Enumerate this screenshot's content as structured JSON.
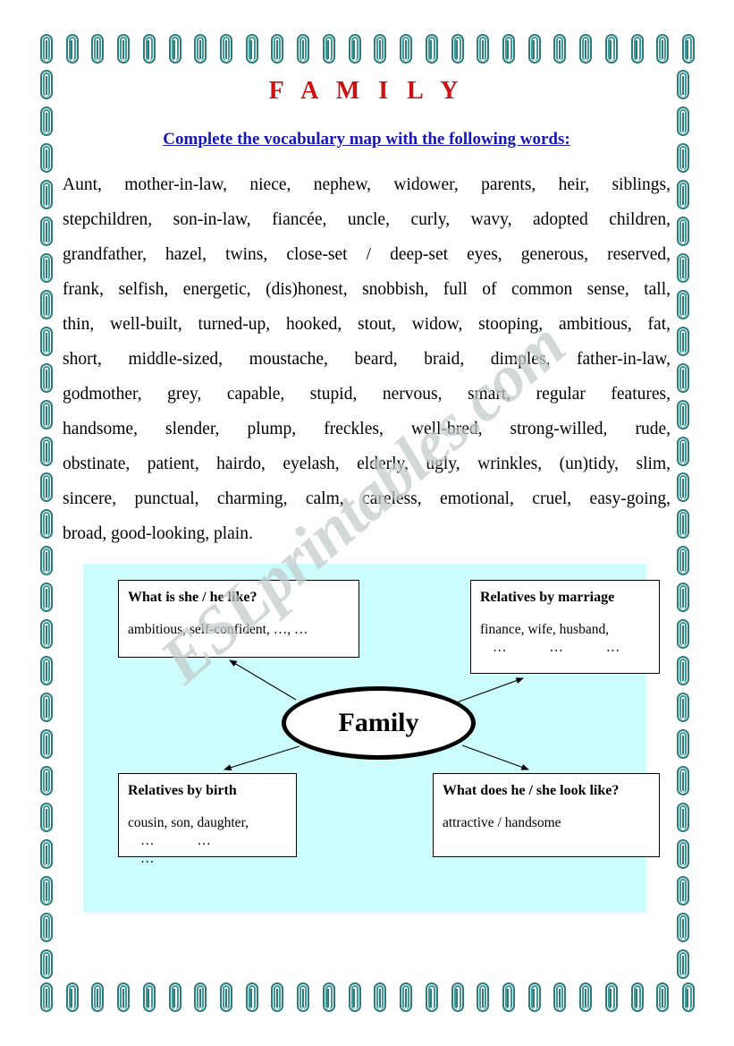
{
  "page": {
    "title": "F A M I L Y",
    "title_color": "#cc1111",
    "subtitle": "Complete the vocabulary map with the following words:",
    "subtitle_color": "#1717b5",
    "watermark": "ESLprintables.com",
    "border_icon": "paperclip-icon",
    "border_color": "#2c7c7c",
    "panel_color": "#ccfcfc"
  },
  "wordlist": {
    "lines": [
      "Aunt, mother-in-law, niece, nephew, widower, parents, heir, siblings,",
      "stepchildren, son-in-law, fiancée, uncle, curly, wavy, adopted children,",
      "grandfather, hazel, twins, close-set / deep-set eyes, generous, reserved,",
      "frank, selfish, energetic, (dis)honest, snobbish, full of common sense, tall,",
      "thin, well-built, turned-up, hooked, stout, widow, stooping, ambitious, fat,",
      "short, middle-sized, moustache, beard, braid, dimples, father-in-law,",
      "godmother, grey, capable, stupid, nervous, smart, regular features,",
      "handsome, slender, plump, freckles, well-bred, strong-willed, rude,",
      "obstinate, patient, hairdo, eyelash, elderly, ugly, wrinkles, (un)tidy, slim,",
      "sincere, punctual, charming, calm, careless, emotional, cruel, easy-going,",
      "broad, good-looking, plain."
    ]
  },
  "diagram": {
    "center_label": "Family",
    "nodes": {
      "character": {
        "heading": "What is she / he like?",
        "body": "ambitious, self-confident, …, …",
        "dots": ""
      },
      "marriage": {
        "heading": "Relatives by marriage",
        "body": "finance, wife, husband,",
        "dots": "…   …   …"
      },
      "birth": {
        "heading": "Relatives by birth",
        "body": "cousin, son, daughter,",
        "dots": "…   …   …"
      },
      "looks": {
        "heading": "What does he / she look like?",
        "body": "attractive / handsome",
        "dots": ""
      }
    }
  }
}
